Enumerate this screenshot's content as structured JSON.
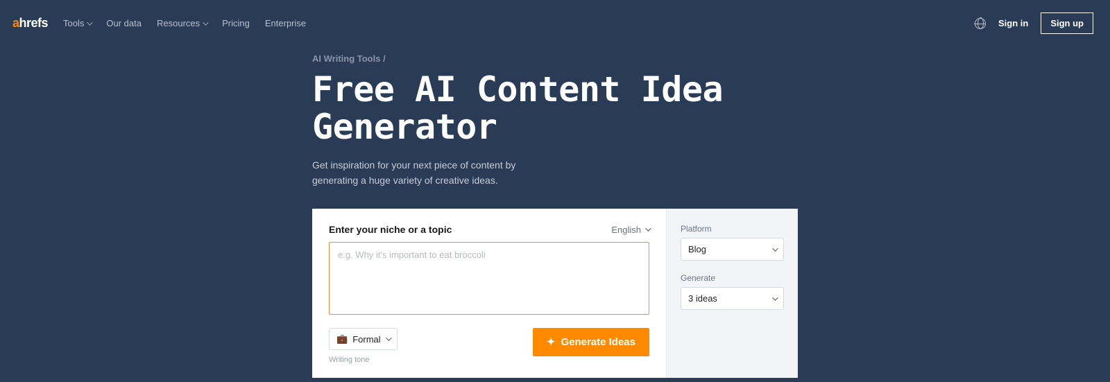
{
  "nav": {
    "logo_a": "a",
    "logo_rest": "hrefs",
    "items": [
      {
        "label": "Tools",
        "has_chevron": true
      },
      {
        "label": "Our data",
        "has_chevron": false
      },
      {
        "label": "Resources",
        "has_chevron": true
      },
      {
        "label": "Pricing",
        "has_chevron": false
      },
      {
        "label": "Enterprise",
        "has_chevron": false
      }
    ],
    "signin": "Sign in",
    "signup": "Sign up"
  },
  "hero": {
    "breadcrumb": "AI Writing Tools /",
    "title": "Free AI Content Idea Generator",
    "subtitle": "Get inspiration for your next piece of content by generating a huge variety of creative ideas."
  },
  "form": {
    "prompt_label": "Enter your niche or a topic",
    "language": "English",
    "placeholder": "e.g. Why it's important to eat broccoli",
    "tone_value": "Formal",
    "tone_caption": "Writing tone",
    "generate_button": "Generate Ideas"
  },
  "side": {
    "platform_label": "Platform",
    "platform_value": "Blog",
    "generate_label": "Generate",
    "generate_value": "3 ideas"
  }
}
